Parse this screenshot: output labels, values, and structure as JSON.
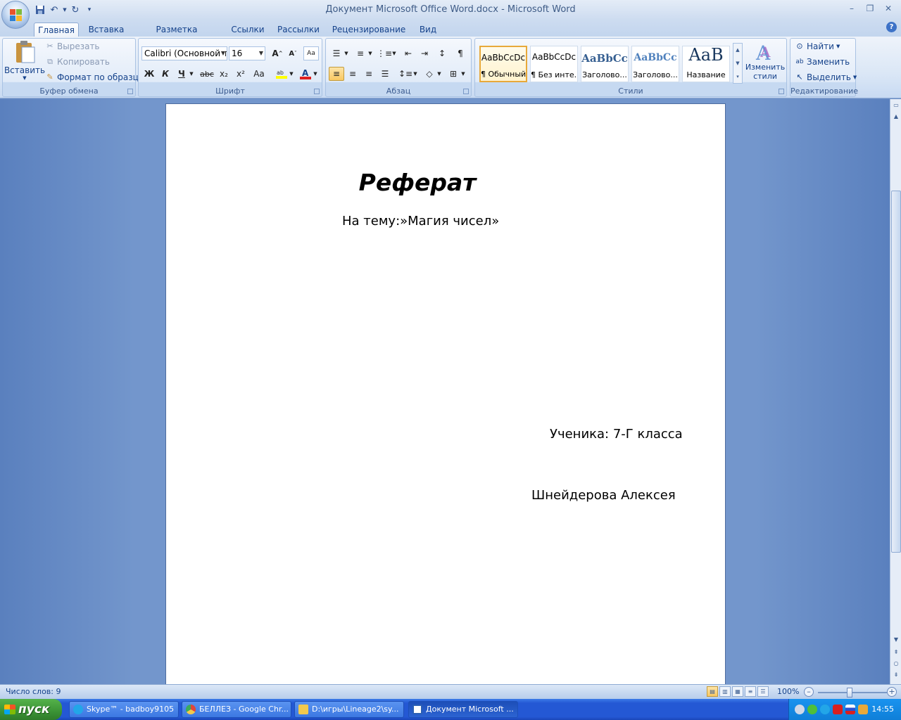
{
  "window": {
    "title": "Документ Microsoft Office Word.docx - Microsoft Word"
  },
  "tabs": [
    "Главная",
    "Вставка",
    "Разметка страницы",
    "Ссылки",
    "Рассылки",
    "Рецензирование",
    "Вид"
  ],
  "ribbon": {
    "clipboard": {
      "label": "Буфер обмена",
      "paste": "Вставить",
      "cut": "Вырезать",
      "copy": "Копировать",
      "format_painter": "Формат по образцу"
    },
    "font": {
      "label": "Шрифт",
      "font_name": "Calibri (Основной текст)",
      "font_size": "16",
      "bold": "Ж",
      "italic": "К",
      "underline": "Ч",
      "strike": "abc",
      "subscript": "x₂",
      "superscript": "x²",
      "change_case": "Aa"
    },
    "paragraph": {
      "label": "Абзац"
    },
    "styles": {
      "label": "Стили",
      "items": [
        {
          "preview": "AaBbCcDc",
          "name": "¶ Обычный"
        },
        {
          "preview": "AaBbCcDc",
          "name": "¶ Без инте..."
        },
        {
          "preview": "AaBbCc",
          "name": "Заголово..."
        },
        {
          "preview": "AaBbCc",
          "name": "Заголово..."
        },
        {
          "preview": "AaB",
          "name": "Название"
        }
      ],
      "change_styles_1": "Изменить",
      "change_styles_2": "стили"
    },
    "editing": {
      "label": "Редактирование",
      "find": "Найти",
      "replace": "Заменить",
      "select": "Выделить"
    }
  },
  "document": {
    "title": "Реферат",
    "subtitle": "На тему:»Магия чисел»",
    "student_line": "Ученика: 7-Г класса",
    "student_name": "Шнейдерова  Алексея"
  },
  "status": {
    "word_count": "Число слов: 9",
    "zoom": "100%"
  },
  "taskbar": {
    "start": "пуск",
    "tasks": [
      {
        "label": "Skype™ - badboy9105",
        "color": "#22a6e8"
      },
      {
        "label": "БЕЛЛЕЗ - Google Chr...",
        "color": "#e0463a"
      },
      {
        "label": "D:\\игры\\Lineage2\\sy...",
        "color": "#f2c94c"
      },
      {
        "label": "Документ Microsoft ...",
        "color": "#2b5fb4"
      }
    ],
    "clock": "14:55"
  }
}
